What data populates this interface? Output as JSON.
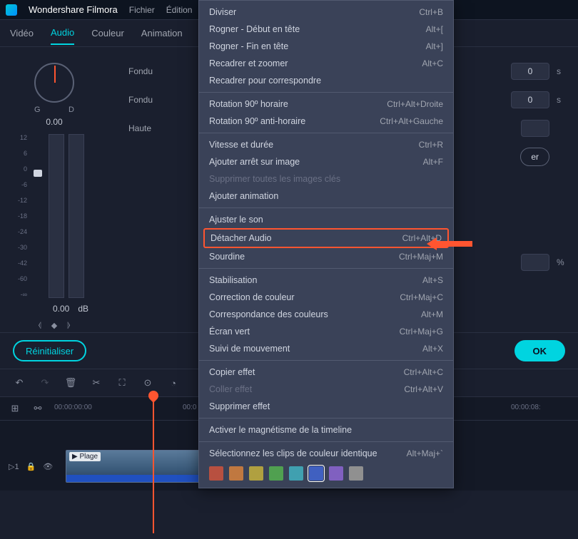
{
  "app": {
    "title": "Wondershare Filmora"
  },
  "menubar": [
    "Fichier",
    "Édition"
  ],
  "prop_tabs": [
    "Vidéo",
    "Audio",
    "Couleur",
    "Animation"
  ],
  "active_tab_index": 1,
  "balance": {
    "left": "G",
    "right": "D",
    "value": "0.00"
  },
  "vu": {
    "ticks": [
      "12",
      "6",
      "0",
      "-6",
      "-12",
      "-18",
      "-24",
      "-30",
      "-42",
      "-60",
      "-∞"
    ],
    "value": "0.00",
    "unit": "dB"
  },
  "form": {
    "fade_in_label": "Fondu",
    "fade_out_label": "Fondu",
    "pitch_label": "Haute",
    "fade_in_val": "0",
    "fade_out_val": "0",
    "unit_s": "s",
    "unit_pct": "%",
    "pill_suffix": "er"
  },
  "buttons": {
    "reset": "Réinitialiser",
    "ok": "OK"
  },
  "ruler": [
    "00:00:00:00",
    "00:0",
    "00:0",
    "00:00:08:"
  ],
  "track": {
    "label": "▷1",
    "clip_name": "▶ Plage"
  },
  "ctx": [
    {
      "t": "item",
      "label": "Diviser",
      "short": "Ctrl+B"
    },
    {
      "t": "item",
      "label": "Rogner - Début en tête",
      "short": "Alt+["
    },
    {
      "t": "item",
      "label": "Rogner - Fin en tête",
      "short": "Alt+]"
    },
    {
      "t": "item",
      "label": "Recadrer et zoomer",
      "short": "Alt+C"
    },
    {
      "t": "item",
      "label": "Recadrer pour correspondre",
      "short": ""
    },
    {
      "t": "sep"
    },
    {
      "t": "item",
      "label": "Rotation 90º horaire",
      "short": "Ctrl+Alt+Droite"
    },
    {
      "t": "item",
      "label": "Rotation 90º anti-horaire",
      "short": "Ctrl+Alt+Gauche"
    },
    {
      "t": "sep"
    },
    {
      "t": "item",
      "label": "Vitesse et durée",
      "short": "Ctrl+R"
    },
    {
      "t": "item",
      "label": "Ajouter arrêt sur image",
      "short": "Alt+F"
    },
    {
      "t": "item",
      "label": "Supprimer toutes les images clés",
      "short": "",
      "disabled": true
    },
    {
      "t": "item",
      "label": "Ajouter animation",
      "short": ""
    },
    {
      "t": "sep"
    },
    {
      "t": "item",
      "label": "Ajuster le son",
      "short": ""
    },
    {
      "t": "item",
      "label": "Détacher Audio",
      "short": "Ctrl+Alt+D",
      "highlight": true
    },
    {
      "t": "item",
      "label": "Sourdine",
      "short": "Ctrl+Maj+M"
    },
    {
      "t": "sep"
    },
    {
      "t": "item",
      "label": "Stabilisation",
      "short": "Alt+S"
    },
    {
      "t": "item",
      "label": "Correction de couleur",
      "short": "Ctrl+Maj+C"
    },
    {
      "t": "item",
      "label": "Correspondance des couleurs",
      "short": "Alt+M"
    },
    {
      "t": "item",
      "label": "Écran vert",
      "short": "Ctrl+Maj+G"
    },
    {
      "t": "item",
      "label": "Suivi de mouvement",
      "short": "Alt+X"
    },
    {
      "t": "sep"
    },
    {
      "t": "item",
      "label": "Copier effet",
      "short": "Ctrl+Alt+C"
    },
    {
      "t": "item",
      "label": "Coller effet",
      "short": "Ctrl+Alt+V",
      "disabled": true
    },
    {
      "t": "item",
      "label": "Supprimer effet",
      "short": ""
    },
    {
      "t": "sep"
    },
    {
      "t": "item",
      "label": "Activer le magnétisme de la timeline",
      "short": ""
    },
    {
      "t": "sep"
    },
    {
      "t": "item",
      "label": "Sélectionnez les clips de couleur identique",
      "short": "Alt+Maj+`"
    }
  ],
  "ctx_colors": [
    "#b85040",
    "#c07840",
    "#b0a040",
    "#50a050",
    "#40a0b0",
    "#4060c0",
    "#8060c0",
    "#909090"
  ],
  "ctx_color_selected": 5
}
